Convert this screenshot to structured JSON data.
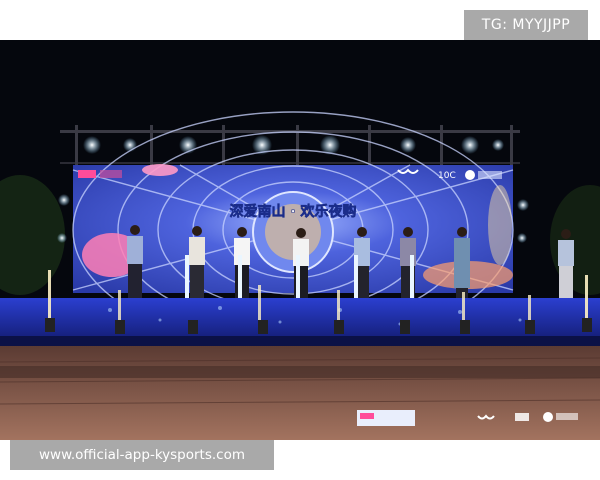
{
  "watermark": {
    "tg_label": "TG: MYYJJPP",
    "url_label": "www.official-app-kysports.com"
  },
  "screen": {
    "title": "深爱南山 · 欢乐夜购",
    "sponsor_marks": [
      "10C"
    ]
  },
  "colors": {
    "screen_blue": "#3f5bd6",
    "stage_blue": "#1d2aa8",
    "sky": "#05070d",
    "floor": "#8a5a4a"
  }
}
